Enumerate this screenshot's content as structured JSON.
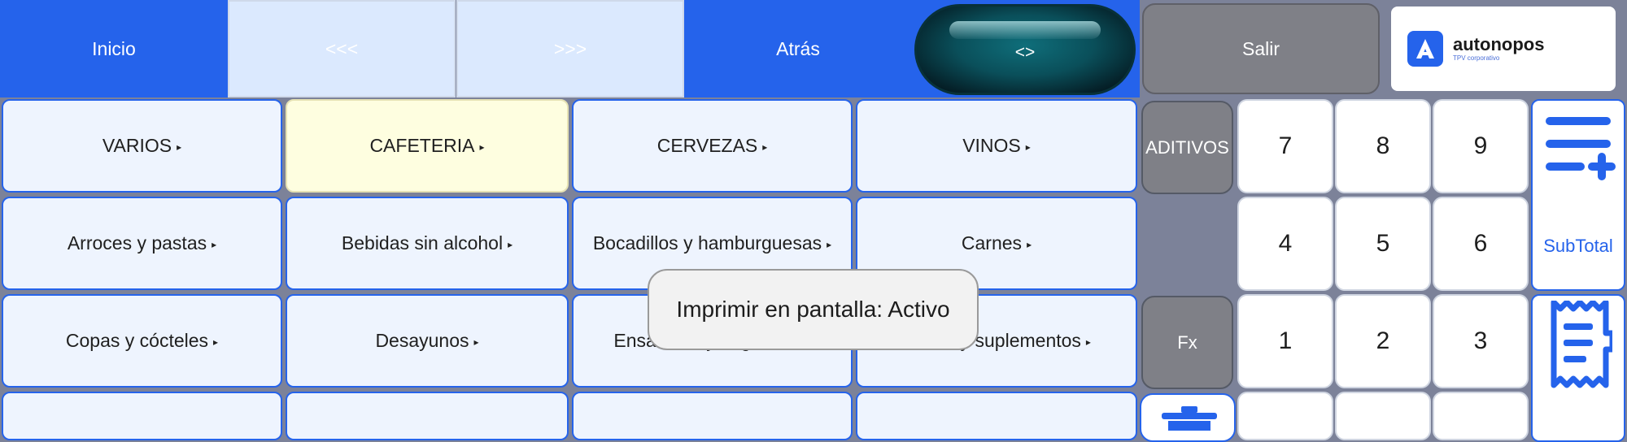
{
  "topbar": {
    "inicio": "Inicio",
    "prev": "<<<",
    "next": ">>>",
    "atras": "Atrás",
    "swap": "<>",
    "salir": "Salir"
  },
  "logo": {
    "title": "autonopos",
    "subtitle": "TPV corporativo"
  },
  "categories": [
    "VARIOS",
    "CAFETERIA",
    "CERVEZAS",
    "VINOS",
    "Arroces y pastas",
    "Bebidas sin alcohol",
    "Bocadillos y hamburguesas",
    "Carnes",
    "Copas y cócteles",
    "Desayunos",
    "Ensaladas y vegetales",
    "Extras y suplementos"
  ],
  "selected_category": "CAFETERIA",
  "side_buttons": {
    "aditivos": "ADITIVOS",
    "fx": "Fx"
  },
  "keypad": [
    "7",
    "8",
    "9",
    "4",
    "5",
    "6",
    "1",
    "2",
    "3"
  ],
  "subtotal_label": "SubTotal",
  "toast": "Imprimir en pantalla: Activo",
  "colors": {
    "accent": "#2563eb",
    "selected": "#fefee0",
    "background": "#7c8299"
  },
  "icons": [
    "add-list-icon",
    "receipt-icon",
    "trash-icon",
    "logo-a-icon",
    "submenu-arrow-icon"
  ]
}
